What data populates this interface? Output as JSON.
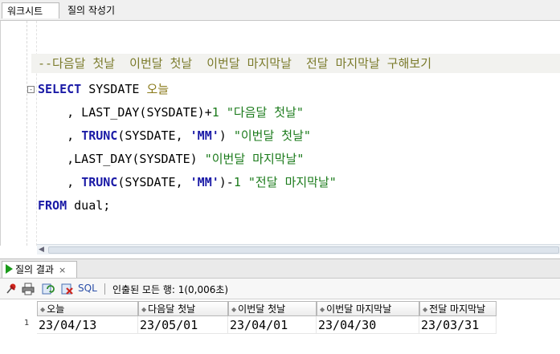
{
  "top_tabs": {
    "worksheet": "워크시트",
    "query_builder": "질의 작성기"
  },
  "editor": {
    "comment": "--다음달 첫날  이번달 첫날  이번달 마지막날  전달 마지막날 구해보기",
    "fold_marker": "-",
    "line1": {
      "kw": "SELECT",
      "rest": " SYSDATE ",
      "alias": "오늘"
    },
    "line2": {
      "prefix": "    , LAST_DAY(SYSDATE)+",
      "num": "1",
      "sp": " ",
      "str": "\"다음달 첫날\""
    },
    "line3": {
      "prefix": "    , ",
      "kw": "TRUNC",
      "mid": "(SYSDATE, ",
      "str1": "'MM'",
      "close": ") ",
      "str2": "\"이번달 첫날\""
    },
    "line4": {
      "prefix": "    ,LAST_DAY(SYSDATE) ",
      "str": "\"이번달 마지막날\""
    },
    "line5": {
      "prefix": "    , ",
      "kw": "TRUNC",
      "mid": "(SYSDATE, ",
      "str1": "'MM'",
      "close": ")-",
      "num": "1",
      "sp": " ",
      "str2": "\"전달 마지막날\""
    },
    "line6": {
      "kw": "FROM",
      "rest": " dual;"
    }
  },
  "result_tab": {
    "label": "질의 결과",
    "close": "×"
  },
  "toolbar": {
    "sql_label": "SQL",
    "status": "인출된 모든 행: 1(0,006초)"
  },
  "grid": {
    "columns": [
      "오늘",
      "다음달 첫날",
      "이번달 첫날",
      "이번달 마지막날",
      "전달 마지막날"
    ],
    "rows": [
      {
        "num": "1",
        "cells": [
          "23/04/13",
          "23/05/01",
          "23/04/01",
          "23/04/30",
          "23/03/31"
        ]
      }
    ]
  },
  "colors": {
    "keyword": "#1a1aa6",
    "string": "#1a7a1a",
    "comment": "#7a7a2a",
    "run_icon": "#1a9a1a"
  }
}
